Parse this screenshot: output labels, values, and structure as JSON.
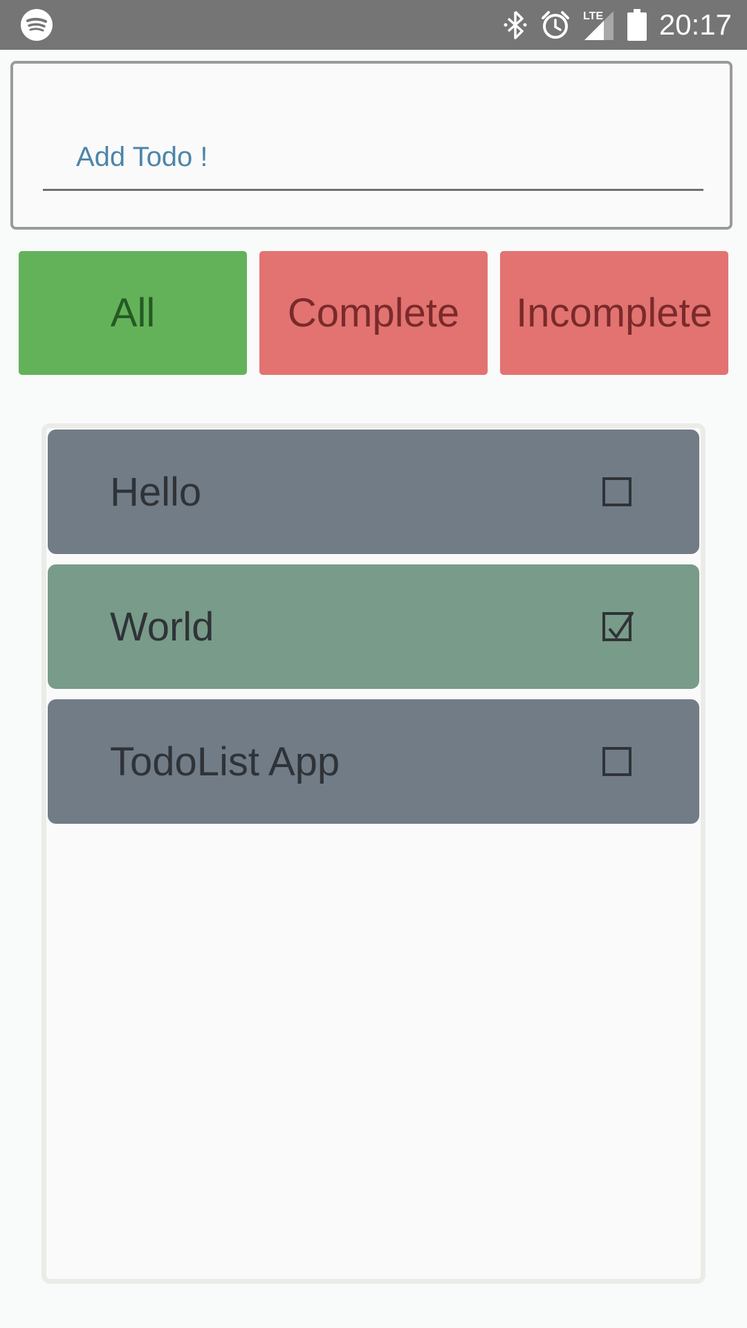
{
  "status_bar": {
    "time": "20:17",
    "left_icon": "spotify-icon",
    "icons": [
      "bluetooth-icon",
      "alarm-icon",
      "lte-signal-icon",
      "battery-icon"
    ],
    "network_label": "LTE",
    "background": "#757575"
  },
  "input": {
    "placeholder": "Add Todo !",
    "value": ""
  },
  "filters": {
    "all_label": "All",
    "complete_label": "Complete",
    "incomplete_label": "Incomplete",
    "active": "All",
    "colors": {
      "active": "#63b25a",
      "inactive": "#e27371"
    }
  },
  "todos": [
    {
      "text": "Hello",
      "done": false,
      "color": "#717c87"
    },
    {
      "text": "World",
      "done": true,
      "color": "#799b89"
    },
    {
      "text": "TodoList App",
      "done": false,
      "color": "#717c87"
    }
  ]
}
